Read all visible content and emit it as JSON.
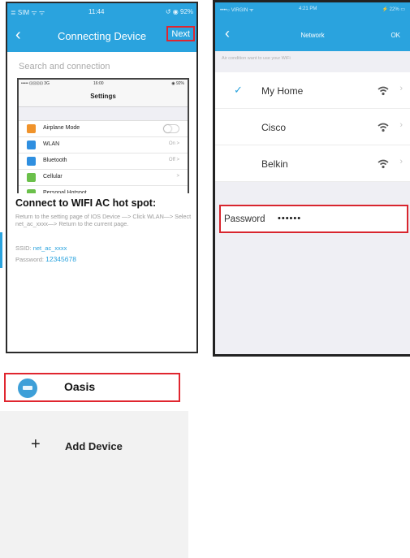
{
  "colors": {
    "accent": "#2aa3de",
    "highlight_red": "#e0262f"
  },
  "left_phone": {
    "status": {
      "carrier": "≣ SIM ᯤ ᯤ",
      "time": "11:44",
      "battery": "↺ ◉ 92%"
    },
    "nav": {
      "back_icon": "chevron-left",
      "title": "Connecting Device",
      "next": "Next"
    },
    "section_label": "Search and connection",
    "inner_phone": {
      "status": {
        "carrier": "••••• ⊡⊡⊡⊡ 3G",
        "time": "16:00",
        "battery": "◉ 92%"
      },
      "title": "Settings",
      "rows": [
        {
          "icon": "airplane-icon",
          "label": "Airplane Mode",
          "value": "",
          "toggle": true,
          "color": "#f0932b"
        },
        {
          "icon": "wifi-icon",
          "label": "WLAN",
          "value": "On >",
          "toggle": false,
          "color": "#2f8fe0"
        },
        {
          "icon": "bluetooth-icon",
          "label": "Bluetooth",
          "value": "Off >",
          "toggle": false,
          "color": "#2f8fe0"
        },
        {
          "icon": "cellular-icon",
          "label": "Cellular",
          "value": ">",
          "toggle": false,
          "color": "#6bc04b"
        },
        {
          "icon": "hotspot-icon",
          "label": "Personal Hotspot",
          "value": "",
          "toggle": false,
          "color": "#6bc04b"
        }
      ]
    },
    "connect_title": "Connect to WIFI AC hot spot:",
    "instructions": "Return to the setting page of IOS Device —> Click WLAN—> Select net_ac_xxxx—> Return to the current page.",
    "ssid_label": "SSID:",
    "ssid_value": "net_ac_xxxx",
    "password_label": "Password:",
    "password_value": "12345678"
  },
  "right_phone": {
    "status": {
      "carrier": "••••○ VIRGIN ᯤ",
      "time": "4:21 PM",
      "battery": "⚡ 22% ▭"
    },
    "nav": {
      "back_icon": "chevron-left",
      "title": "Network",
      "ok": "OK"
    },
    "hint": "Air condition want to use your WiFi",
    "networks": [
      {
        "name": "My Home",
        "selected": true
      },
      {
        "name": "Cisco",
        "selected": false
      },
      {
        "name": "Belkin",
        "selected": false
      }
    ],
    "password_label": "Password",
    "password_value": "••••••"
  },
  "device_panel": {
    "device_name": "Oasis",
    "add_icon": "+",
    "add_label": "Add Device"
  }
}
